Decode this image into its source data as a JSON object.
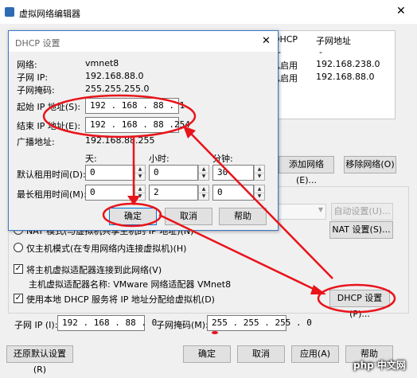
{
  "main": {
    "title": "虚拟网络编辑器",
    "table": {
      "headers": [
        "DHCP",
        "子网地址"
      ],
      "rows": [
        [
          "-",
          "-"
        ],
        [
          "已启用",
          "192.168.238.0"
        ],
        [
          "已启用",
          "192.168.88.0"
        ]
      ]
    },
    "add_network": "添加网络(E)...",
    "remove_network": "移除网络(O)",
    "auto_settings": "自动设置(U)...",
    "nat_settings": "NAT 设置(S)...",
    "nat_mode_label": "NAT 模式(与虚拟机共享主机的 IP 地址)(N)",
    "host_only_label": "仅主机模式(在专用网络内连接虚拟机)(H)",
    "connect_adapter_label": "将主机虚拟适配器连接到此网络(V)",
    "adapter_name_label": "主机虚拟适配器名称: VMware 网络适配器 VMnet8",
    "use_dhcp_label": "使用本地 DHCP 服务将 IP 地址分配给虚拟机(D)",
    "dhcp_settings": "DHCP 设置(P)...",
    "subnet_ip_label": "子网 IP (I):",
    "subnet_ip": "192 . 168 . 88 . 0",
    "subnet_mask_label": "子网掩码(M):",
    "subnet_mask": "255 . 255 . 255 . 0",
    "restore_defaults": "还原默认设置(R)",
    "ok": "确定",
    "cancel": "取消",
    "apply": "应用(A)",
    "help": "帮助"
  },
  "dhcp": {
    "title": "DHCP 设置",
    "network_label": "网络:",
    "network": "vmnet8",
    "subnet_ip_label": "子网 IP:",
    "subnet_ip": "192.168.88.0",
    "subnet_mask_label": "子网掩码:",
    "subnet_mask": "255.255.255.0",
    "start_ip_label": "起始 IP 地址(S):",
    "start_ip": "192 . 168 . 88 . 1",
    "end_ip_label": "结束 IP 地址(E):",
    "end_ip": "192 . 168 . 88 .254",
    "broadcast_label": "广播地址:",
    "broadcast": "192.168.88.255",
    "days_label": "天:",
    "hours_label": "小时:",
    "minutes_label": "分钟:",
    "default_lease_label": "默认租用时间(D):",
    "default_lease": [
      "0",
      "0",
      "30"
    ],
    "max_lease_label": "最长租用时间(M):",
    "max_lease": [
      "0",
      "2",
      "0"
    ],
    "ok": "确定",
    "cancel": "取消",
    "help": "帮助"
  },
  "watermark": "php 中文网",
  "colors": {
    "annotation": "#e8141b"
  }
}
